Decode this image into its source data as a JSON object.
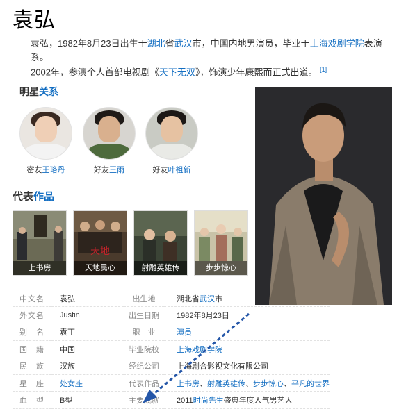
{
  "title": "袁弘",
  "intro": {
    "p1_a": "袁弘，1982年8月23日出生于",
    "p1_hubei": "湖北",
    "p1_b": "省",
    "p1_wuhan": "武汉",
    "p1_c": "市，中国内地男演员，毕业于",
    "p1_school": "上海戏剧学院",
    "p1_d": "表演系。",
    "p2_a": "2002年，参演个人首部电视剧《",
    "p2_drama": "天下无双",
    "p2_b": "》，饰演少年康熙而正式出道。",
    "p2_ref": "[1]"
  },
  "stars": {
    "title_a": "明星",
    "title_b": "关系",
    "items": [
      {
        "relation": "密友",
        "name": "王珞丹"
      },
      {
        "relation": "好友",
        "name": "王雨"
      },
      {
        "relation": "好友",
        "name": "叶祖新"
      }
    ]
  },
  "works": {
    "title_a": "代表",
    "title_b": "作品",
    "items": [
      {
        "label": "上书房"
      },
      {
        "label": "天地民心"
      },
      {
        "label": "射雕英雄传"
      },
      {
        "label": "步步惊心"
      }
    ]
  },
  "info": [
    {
      "k1": "中文名",
      "v1": "袁弘",
      "k2": "出生地",
      "v2a": "湖北省",
      "v2link": "武汉",
      "v2b": "市"
    },
    {
      "k1": "外文名",
      "v1": "Justin",
      "k2": "出生日期",
      "v2": "1982年8月23日"
    },
    {
      "k1": "别　名",
      "v1": "袁丁",
      "k2": "职　业",
      "v2link": "演员"
    },
    {
      "k1": "国　籍",
      "v1": "中国",
      "k2": "毕业院校",
      "v2link": "上海戏剧学院"
    },
    {
      "k1": "民　族",
      "v1": "汉族",
      "k2": "经纪公司",
      "v2": "上海剧合影视文化有限公司"
    },
    {
      "k1": "星　座",
      "v1link": "处女座",
      "k2": "代表作品",
      "v2links": [
        "上书房",
        "射雕英雄传",
        "步步惊心",
        "平凡的世界"
      ]
    },
    {
      "k1": "血　型",
      "v1": "B型",
      "k2": "主要成就",
      "v2a": "2011",
      "v2link": "时尚先生",
      "v2b": "盛典年度人气男艺人"
    }
  ],
  "colors": {
    "link": "#136ec2",
    "arrow": "#2456a8"
  }
}
